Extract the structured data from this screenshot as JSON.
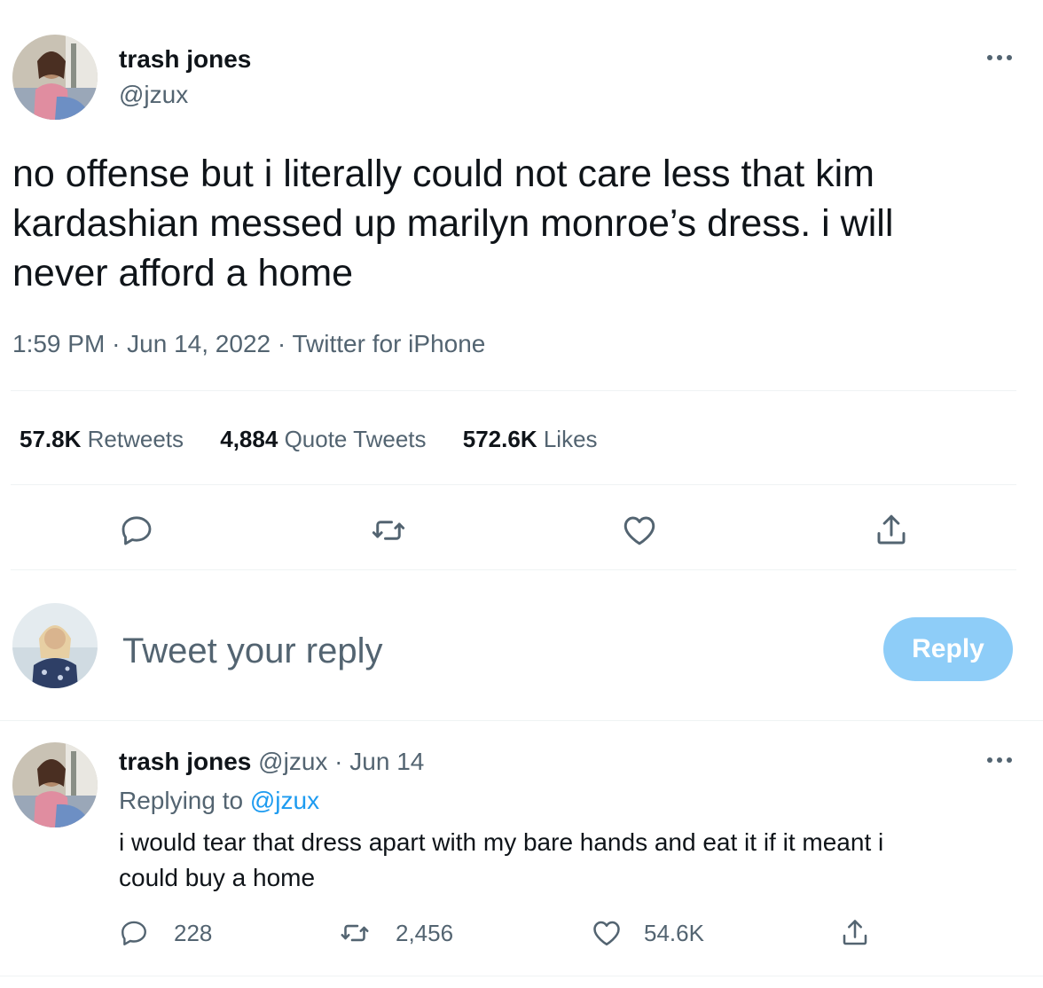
{
  "tweet": {
    "author_name": "trash jones",
    "author_handle": "@jzux",
    "more_icon": "ellipsis-icon",
    "text": "no offense but i literally could not care less that kim kardashian messed up marilyn monroe’s dress. i will never afford a home",
    "time": "1:59 PM",
    "date": "Jun 14, 2022",
    "source": "Twitter for iPhone",
    "separator": "·",
    "stats": {
      "retweets_count": "57.8K",
      "retweets_label": "Retweets",
      "quotes_count": "4,884",
      "quotes_label": "Quote Tweets",
      "likes_count": "572.6K",
      "likes_label": "Likes"
    },
    "actions": [
      "reply-icon",
      "retweet-icon",
      "like-icon",
      "share-icon"
    ]
  },
  "compose": {
    "placeholder": "Tweet your reply",
    "reply_button": "Reply",
    "reply_button_color": "#8ecdf8"
  },
  "reply": {
    "author_name": "trash jones",
    "author_handle": "@jzux",
    "date": "Jun 14",
    "separator": "·",
    "replying_prefix": "Replying to",
    "replying_to": "@jzux",
    "text_line1": "i would tear that dress apart with my bare hands and eat it if it meant i",
    "text_line2": "could buy a home",
    "counts": {
      "replies": "228",
      "retweets": "2,456",
      "likes": "54.6K"
    }
  },
  "colors": {
    "accent": "#1d9bf0",
    "muted": "#536471",
    "text": "#0f1419",
    "divider": "#eff3f4"
  }
}
